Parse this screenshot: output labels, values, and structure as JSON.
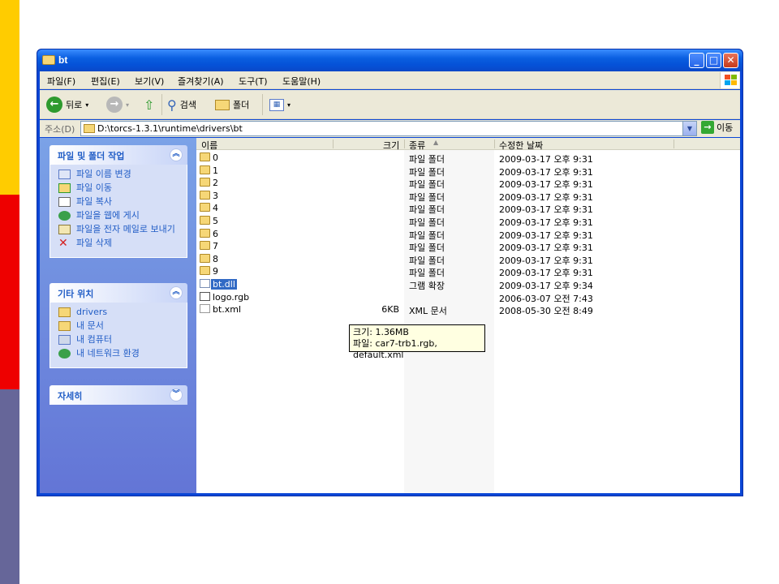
{
  "window": {
    "title": "bt"
  },
  "menu": [
    "파일(F)",
    "편집(E)",
    "보기(V)",
    "즐겨찾기(A)",
    "도구(T)",
    "도움말(H)"
  ],
  "toolbar": {
    "back_label": "뒤로",
    "search_label": "검색",
    "folders_label": "폴더"
  },
  "address": {
    "label": "주소(D)",
    "path": "D:\\torcs-1.3.1\\runtime\\drivers\\bt",
    "go_label": "이동"
  },
  "taskpane": {
    "file_tasks": {
      "title": "파일 및 폴더 작업",
      "items": [
        "파일 이름 변경",
        "파일 이동",
        "파일 복사",
        "파일을 웹에 게시",
        "파일을 전자 메일로 보내기",
        "파일 삭제"
      ]
    },
    "other_places": {
      "title": "기타 위치",
      "items": [
        "drivers",
        "내 문서",
        "내 컴퓨터",
        "내 네트워크 환경"
      ]
    },
    "details": {
      "title": "자세히"
    }
  },
  "columns": {
    "name": "이름",
    "size": "크기",
    "type": "종류",
    "date": "수정한 날짜"
  },
  "files": [
    {
      "name": "0",
      "size": "",
      "type": "파일 폴더",
      "date": "2009-03-17 오후 9:31",
      "kind": "folder"
    },
    {
      "name": "1",
      "size": "",
      "type": "파일 폴더",
      "date": "2009-03-17 오후 9:31",
      "kind": "folder"
    },
    {
      "name": "2",
      "size": "",
      "type": "파일 폴더",
      "date": "2009-03-17 오후 9:31",
      "kind": "folder"
    },
    {
      "name": "3",
      "size": "",
      "type": "파일 폴더",
      "date": "2009-03-17 오후 9:31",
      "kind": "folder"
    },
    {
      "name": "4",
      "size": "",
      "type": "파일 폴더",
      "date": "2009-03-17 오후 9:31",
      "kind": "folder"
    },
    {
      "name": "5",
      "size": "",
      "type": "파일 폴더",
      "date": "2009-03-17 오후 9:31",
      "kind": "folder"
    },
    {
      "name": "6",
      "size": "",
      "type": "파일 폴더",
      "date": "2009-03-17 오후 9:31",
      "kind": "folder"
    },
    {
      "name": "7",
      "size": "",
      "type": "파일 폴더",
      "date": "2009-03-17 오후 9:31",
      "kind": "folder"
    },
    {
      "name": "8",
      "size": "",
      "type": "파일 폴더",
      "date": "2009-03-17 오후 9:31",
      "kind": "folder"
    },
    {
      "name": "9",
      "size": "",
      "type": "파일 폴더",
      "date": "2009-03-17 오후 9:31",
      "kind": "folder"
    },
    {
      "name": "bt.dll",
      "size": "",
      "type": "그램 확장",
      "date": "2009-03-17 오후 9:34",
      "kind": "dll"
    },
    {
      "name": "logo.rgb",
      "size": "",
      "type": "",
      "date": "2006-03-07 오전 7:43",
      "kind": "rgb"
    },
    {
      "name": "bt.xml",
      "size": "6KB",
      "type": "XML 문서",
      "date": "2008-05-30 오전 8:49",
      "kind": "xml"
    }
  ],
  "tooltip": {
    "line1": "크기: 1.36MB",
    "line2": "파일: car7-trb1.rgb, default.xml"
  }
}
